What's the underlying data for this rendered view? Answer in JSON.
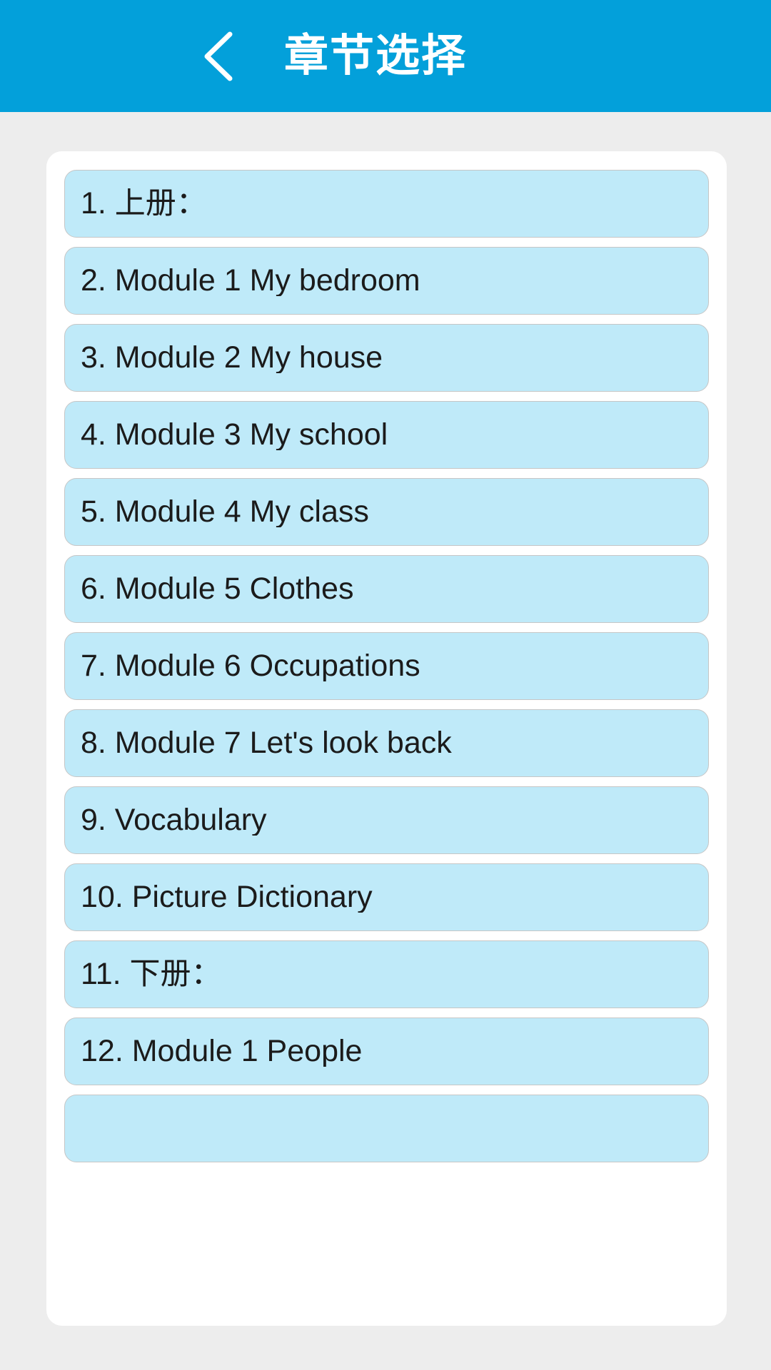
{
  "header": {
    "title": "章节选择",
    "back_icon": "chevron-left-icon",
    "background_color": "#03a0da",
    "text_color": "#ffffff"
  },
  "theme": {
    "page_background": "#ededed",
    "card_background": "#ffffff",
    "item_background": "#bfeaf9",
    "item_border": "#c6c6c6",
    "item_text": "#1b1b1b"
  },
  "chapter_list": {
    "items": [
      {
        "label": "1. 上册："
      },
      {
        "label": "2. Module 1 My bedroom"
      },
      {
        "label": "3. Module 2 My house"
      },
      {
        "label": "4. Module 3 My school"
      },
      {
        "label": "5. Module 4 My class"
      },
      {
        "label": "6. Module 5 Clothes"
      },
      {
        "label": "7. Module 6 Occupations"
      },
      {
        "label": "8. Module 7 Let's look back"
      },
      {
        "label": "9. Vocabulary"
      },
      {
        "label": "10. Picture Dictionary"
      },
      {
        "label": "11. 下册："
      },
      {
        "label": "12. Module 1 People"
      },
      {
        "label": ""
      }
    ]
  }
}
